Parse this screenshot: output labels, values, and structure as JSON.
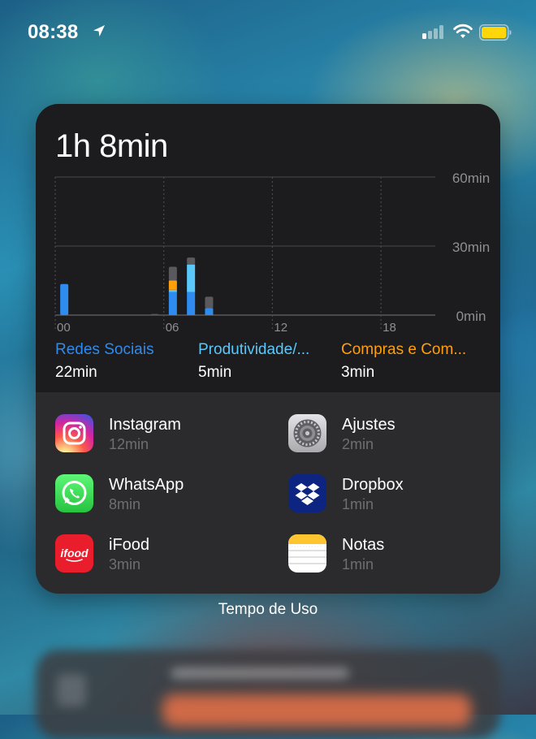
{
  "status_bar": {
    "time": "08:38",
    "location_icon": "location-arrow-icon",
    "signal_bars_active": 1,
    "signal_bars_total": 4,
    "battery_color": "#FFD60A"
  },
  "widget": {
    "total_time": "1h 8min",
    "label": "Tempo de Uso",
    "categories": [
      {
        "name": "Redes Sociais",
        "time": "22min",
        "color": "#2E8BEF"
      },
      {
        "name": "Produtividade/...",
        "time": "5min",
        "color": "#5AC8FA"
      },
      {
        "name": "Compras e Com...",
        "time": "3min",
        "color": "#FF9F0A"
      }
    ],
    "apps": [
      {
        "name": "Instagram",
        "time": "12min",
        "icon": "instagram-icon"
      },
      {
        "name": "Ajustes",
        "time": "2min",
        "icon": "settings-gear-icon"
      },
      {
        "name": "WhatsApp",
        "time": "8min",
        "icon": "whatsapp-icon"
      },
      {
        "name": "Dropbox",
        "time": "1min",
        "icon": "dropbox-icon"
      },
      {
        "name": "iFood",
        "time": "3min",
        "icon": "ifood-icon"
      },
      {
        "name": "Notas",
        "time": "1min",
        "icon": "notes-icon"
      }
    ]
  },
  "chart_data": {
    "type": "bar",
    "stacked": true,
    "x_tick_labels": [
      "00",
      "06",
      "12",
      "18"
    ],
    "y_tick_labels": [
      "60min",
      "30min",
      "0min"
    ],
    "ylim": [
      0,
      60
    ],
    "grid": true,
    "x_unit": "hour",
    "bars": [
      {
        "hour": 0,
        "segments": {
          "Redes Sociais": 13.5,
          "Produtividade": 0,
          "Compras": 0,
          "Outros": 0
        }
      },
      {
        "hour": 5,
        "segments": {
          "Redes Sociais": 0,
          "Produtividade": 0,
          "Compras": 0,
          "Outros": 0.5
        }
      },
      {
        "hour": 6,
        "segments": {
          "Redes Sociais": 10,
          "Produtividade": 1,
          "Compras": 4,
          "Outros": 6
        }
      },
      {
        "hour": 7,
        "segments": {
          "Redes Sociais": 10,
          "Produtividade": 12,
          "Compras": 0,
          "Outros": 3
        }
      },
      {
        "hour": 8,
        "segments": {
          "Redes Sociais": 3,
          "Produtividade": 0,
          "Compras": 0,
          "Outros": 5
        }
      }
    ],
    "series_colors": {
      "Redes Sociais": "#2E8BEF",
      "Produtividade": "#5AC8FA",
      "Compras": "#FF9F0A",
      "Outros": "#5A5A5E"
    }
  }
}
